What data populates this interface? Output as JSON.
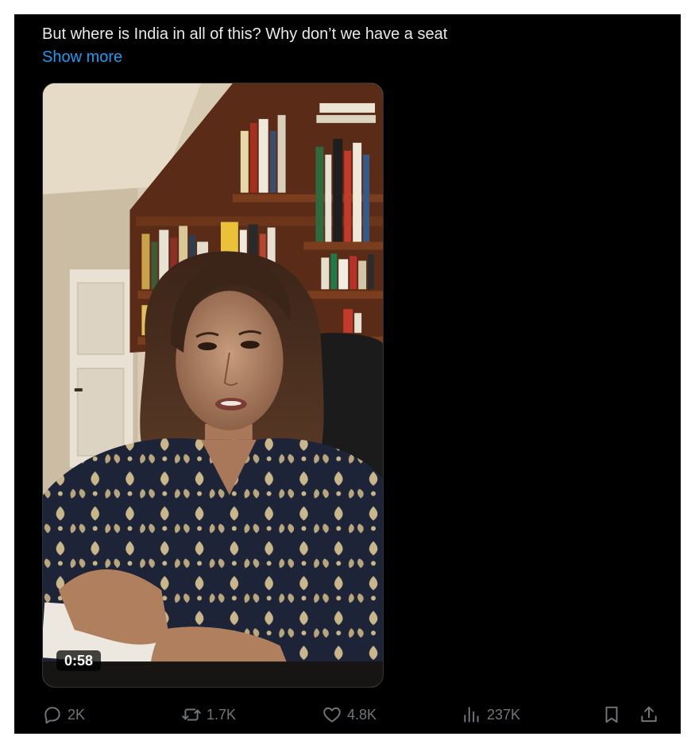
{
  "tweet": {
    "text": "But where is India in all of this? Why don’t we have a seat",
    "show_more": "Show more"
  },
  "media": {
    "duration": "0:58"
  },
  "actions": {
    "replies": "2K",
    "reposts": "1.7K",
    "likes": "4.8K",
    "views": "237K"
  },
  "icons": {
    "reply": "reply-icon",
    "repost": "repost-icon",
    "like": "heart-icon",
    "views": "views-icon",
    "bookmark": "bookmark-icon",
    "share": "share-icon"
  },
  "colors": {
    "background": "#000000",
    "text": "#e7e9ea",
    "link": "#1d9bf0",
    "muted": "#71767b"
  }
}
